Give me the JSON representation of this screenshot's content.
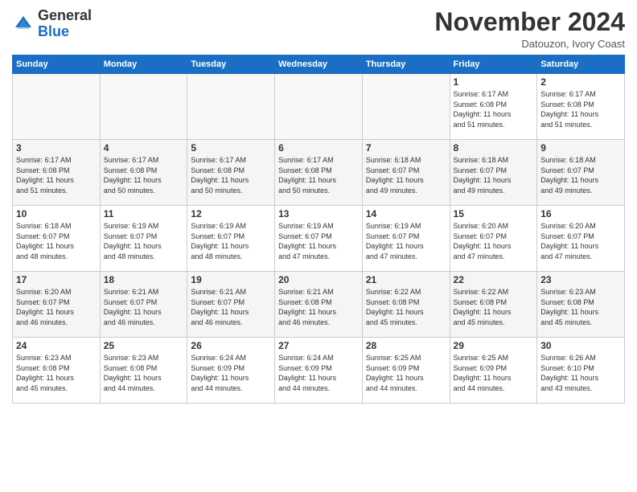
{
  "header": {
    "logo_general": "General",
    "logo_blue": "Blue",
    "month_title": "November 2024",
    "subtitle": "Datouzon, Ivory Coast"
  },
  "days_of_week": [
    "Sunday",
    "Monday",
    "Tuesday",
    "Wednesday",
    "Thursday",
    "Friday",
    "Saturday"
  ],
  "weeks": [
    [
      {
        "day": "",
        "info": "",
        "empty": true
      },
      {
        "day": "",
        "info": "",
        "empty": true
      },
      {
        "day": "",
        "info": "",
        "empty": true
      },
      {
        "day": "",
        "info": "",
        "empty": true
      },
      {
        "day": "",
        "info": "",
        "empty": true
      },
      {
        "day": "1",
        "info": "Sunrise: 6:17 AM\nSunset: 6:08 PM\nDaylight: 11 hours\nand 51 minutes."
      },
      {
        "day": "2",
        "info": "Sunrise: 6:17 AM\nSunset: 6:08 PM\nDaylight: 11 hours\nand 51 minutes."
      }
    ],
    [
      {
        "day": "3",
        "info": "Sunrise: 6:17 AM\nSunset: 6:08 PM\nDaylight: 11 hours\nand 51 minutes."
      },
      {
        "day": "4",
        "info": "Sunrise: 6:17 AM\nSunset: 6:08 PM\nDaylight: 11 hours\nand 50 minutes."
      },
      {
        "day": "5",
        "info": "Sunrise: 6:17 AM\nSunset: 6:08 PM\nDaylight: 11 hours\nand 50 minutes."
      },
      {
        "day": "6",
        "info": "Sunrise: 6:17 AM\nSunset: 6:08 PM\nDaylight: 11 hours\nand 50 minutes."
      },
      {
        "day": "7",
        "info": "Sunrise: 6:18 AM\nSunset: 6:07 PM\nDaylight: 11 hours\nand 49 minutes."
      },
      {
        "day": "8",
        "info": "Sunrise: 6:18 AM\nSunset: 6:07 PM\nDaylight: 11 hours\nand 49 minutes."
      },
      {
        "day": "9",
        "info": "Sunrise: 6:18 AM\nSunset: 6:07 PM\nDaylight: 11 hours\nand 49 minutes."
      }
    ],
    [
      {
        "day": "10",
        "info": "Sunrise: 6:18 AM\nSunset: 6:07 PM\nDaylight: 11 hours\nand 48 minutes."
      },
      {
        "day": "11",
        "info": "Sunrise: 6:19 AM\nSunset: 6:07 PM\nDaylight: 11 hours\nand 48 minutes."
      },
      {
        "day": "12",
        "info": "Sunrise: 6:19 AM\nSunset: 6:07 PM\nDaylight: 11 hours\nand 48 minutes."
      },
      {
        "day": "13",
        "info": "Sunrise: 6:19 AM\nSunset: 6:07 PM\nDaylight: 11 hours\nand 47 minutes."
      },
      {
        "day": "14",
        "info": "Sunrise: 6:19 AM\nSunset: 6:07 PM\nDaylight: 11 hours\nand 47 minutes."
      },
      {
        "day": "15",
        "info": "Sunrise: 6:20 AM\nSunset: 6:07 PM\nDaylight: 11 hours\nand 47 minutes."
      },
      {
        "day": "16",
        "info": "Sunrise: 6:20 AM\nSunset: 6:07 PM\nDaylight: 11 hours\nand 47 minutes."
      }
    ],
    [
      {
        "day": "17",
        "info": "Sunrise: 6:20 AM\nSunset: 6:07 PM\nDaylight: 11 hours\nand 46 minutes."
      },
      {
        "day": "18",
        "info": "Sunrise: 6:21 AM\nSunset: 6:07 PM\nDaylight: 11 hours\nand 46 minutes."
      },
      {
        "day": "19",
        "info": "Sunrise: 6:21 AM\nSunset: 6:07 PM\nDaylight: 11 hours\nand 46 minutes."
      },
      {
        "day": "20",
        "info": "Sunrise: 6:21 AM\nSunset: 6:08 PM\nDaylight: 11 hours\nand 46 minutes."
      },
      {
        "day": "21",
        "info": "Sunrise: 6:22 AM\nSunset: 6:08 PM\nDaylight: 11 hours\nand 45 minutes."
      },
      {
        "day": "22",
        "info": "Sunrise: 6:22 AM\nSunset: 6:08 PM\nDaylight: 11 hours\nand 45 minutes."
      },
      {
        "day": "23",
        "info": "Sunrise: 6:23 AM\nSunset: 6:08 PM\nDaylight: 11 hours\nand 45 minutes."
      }
    ],
    [
      {
        "day": "24",
        "info": "Sunrise: 6:23 AM\nSunset: 6:08 PM\nDaylight: 11 hours\nand 45 minutes."
      },
      {
        "day": "25",
        "info": "Sunrise: 6:23 AM\nSunset: 6:08 PM\nDaylight: 11 hours\nand 44 minutes."
      },
      {
        "day": "26",
        "info": "Sunrise: 6:24 AM\nSunset: 6:09 PM\nDaylight: 11 hours\nand 44 minutes."
      },
      {
        "day": "27",
        "info": "Sunrise: 6:24 AM\nSunset: 6:09 PM\nDaylight: 11 hours\nand 44 minutes."
      },
      {
        "day": "28",
        "info": "Sunrise: 6:25 AM\nSunset: 6:09 PM\nDaylight: 11 hours\nand 44 minutes."
      },
      {
        "day": "29",
        "info": "Sunrise: 6:25 AM\nSunset: 6:09 PM\nDaylight: 11 hours\nand 44 minutes."
      },
      {
        "day": "30",
        "info": "Sunrise: 6:26 AM\nSunset: 6:10 PM\nDaylight: 11 hours\nand 43 minutes."
      }
    ]
  ]
}
